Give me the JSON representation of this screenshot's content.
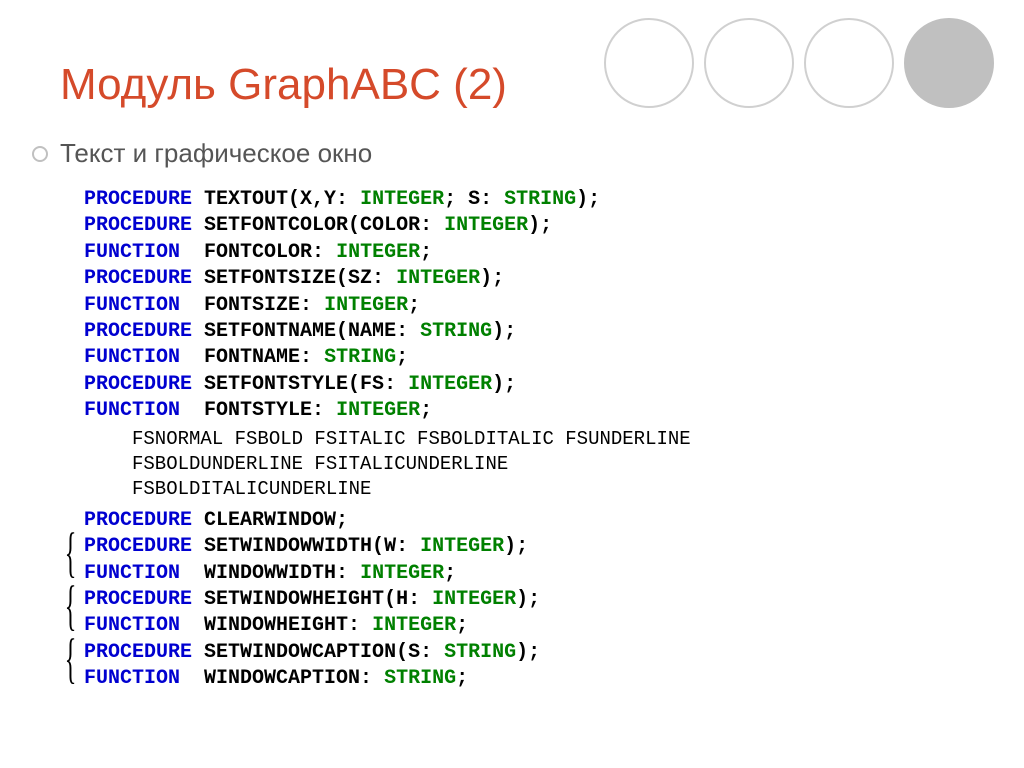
{
  "title": "Модуль GraphABC (2)",
  "subtitle": "Текст и графическое окно",
  "lines": {
    "l1": {
      "kw": "PROCEDURE",
      "name": " TEXTOUT(X,Y: ",
      "ty1": "INTEGER",
      "mid": "; S: ",
      "ty2": "STRING",
      "end": ");"
    },
    "l2": {
      "kw": "PROCEDURE",
      "name": " SETFONTCOLOR(COLOR: ",
      "ty": "INTEGER",
      "end": ");"
    },
    "l3": {
      "kw": "FUNCTION ",
      "name": " FONTCOLOR: ",
      "ty": "INTEGER",
      "end": ";"
    },
    "l4": {
      "kw": "PROCEDURE",
      "name": " SETFONTSIZE(SZ: ",
      "ty": "INTEGER",
      "end": ");"
    },
    "l5": {
      "kw": "FUNCTION ",
      "name": " FONTSIZE: ",
      "ty": "INTEGER",
      "end": ";"
    },
    "l6": {
      "kw": "PROCEDURE",
      "name": " SETFONTNAME(NAME: ",
      "ty": "STRING",
      "end": ");"
    },
    "l7": {
      "kw": "FUNCTION ",
      "name": " FONTNAME: ",
      "ty": "STRING",
      "end": ";"
    },
    "l8": {
      "kw": "PROCEDURE",
      "name": " SETFONTSTYLE(FS: ",
      "ty": "INTEGER",
      "end": ");"
    },
    "l9": {
      "kw": "FUNCTION ",
      "name": " FONTSTYLE: ",
      "ty": "INTEGER",
      "end": ";"
    }
  },
  "styles_line1": "FSNORMAL FSBOLD FSITALIC FSBOLDITALIC FSUNDERLINE",
  "styles_line2": "FSBOLDUNDERLINE FSITALICUNDERLINE",
  "styles_line3": "FSBOLDITALICUNDERLINE",
  "block2": {
    "clear": {
      "kw": "PROCEDURE",
      "name": " CLEARWINDOW;"
    },
    "g1a": {
      "kw": "PROCEDURE",
      "name": " SETWINDOWWIDTH(W: ",
      "ty": "INTEGER",
      "end": ");"
    },
    "g1b": {
      "kw": "FUNCTION ",
      "name": " WINDOWWIDTH: ",
      "ty": "INTEGER",
      "end": ";"
    },
    "g2a": {
      "kw": "PROCEDURE",
      "name": " SETWINDOWHEIGHT(H: ",
      "ty": "INTEGER",
      "end": ");"
    },
    "g2b": {
      "kw": "FUNCTION ",
      "name": " WINDOWHEIGHT: ",
      "ty": "INTEGER",
      "end": ";"
    },
    "g3a": {
      "kw": "PROCEDURE",
      "name": " SETWINDOWCAPTION(S: ",
      "ty": "STRING",
      "end": ");"
    },
    "g3b": {
      "kw": "FUNCTION ",
      "name": " WINDOWCAPTION: ",
      "ty": "STRING",
      "end": ";"
    }
  }
}
